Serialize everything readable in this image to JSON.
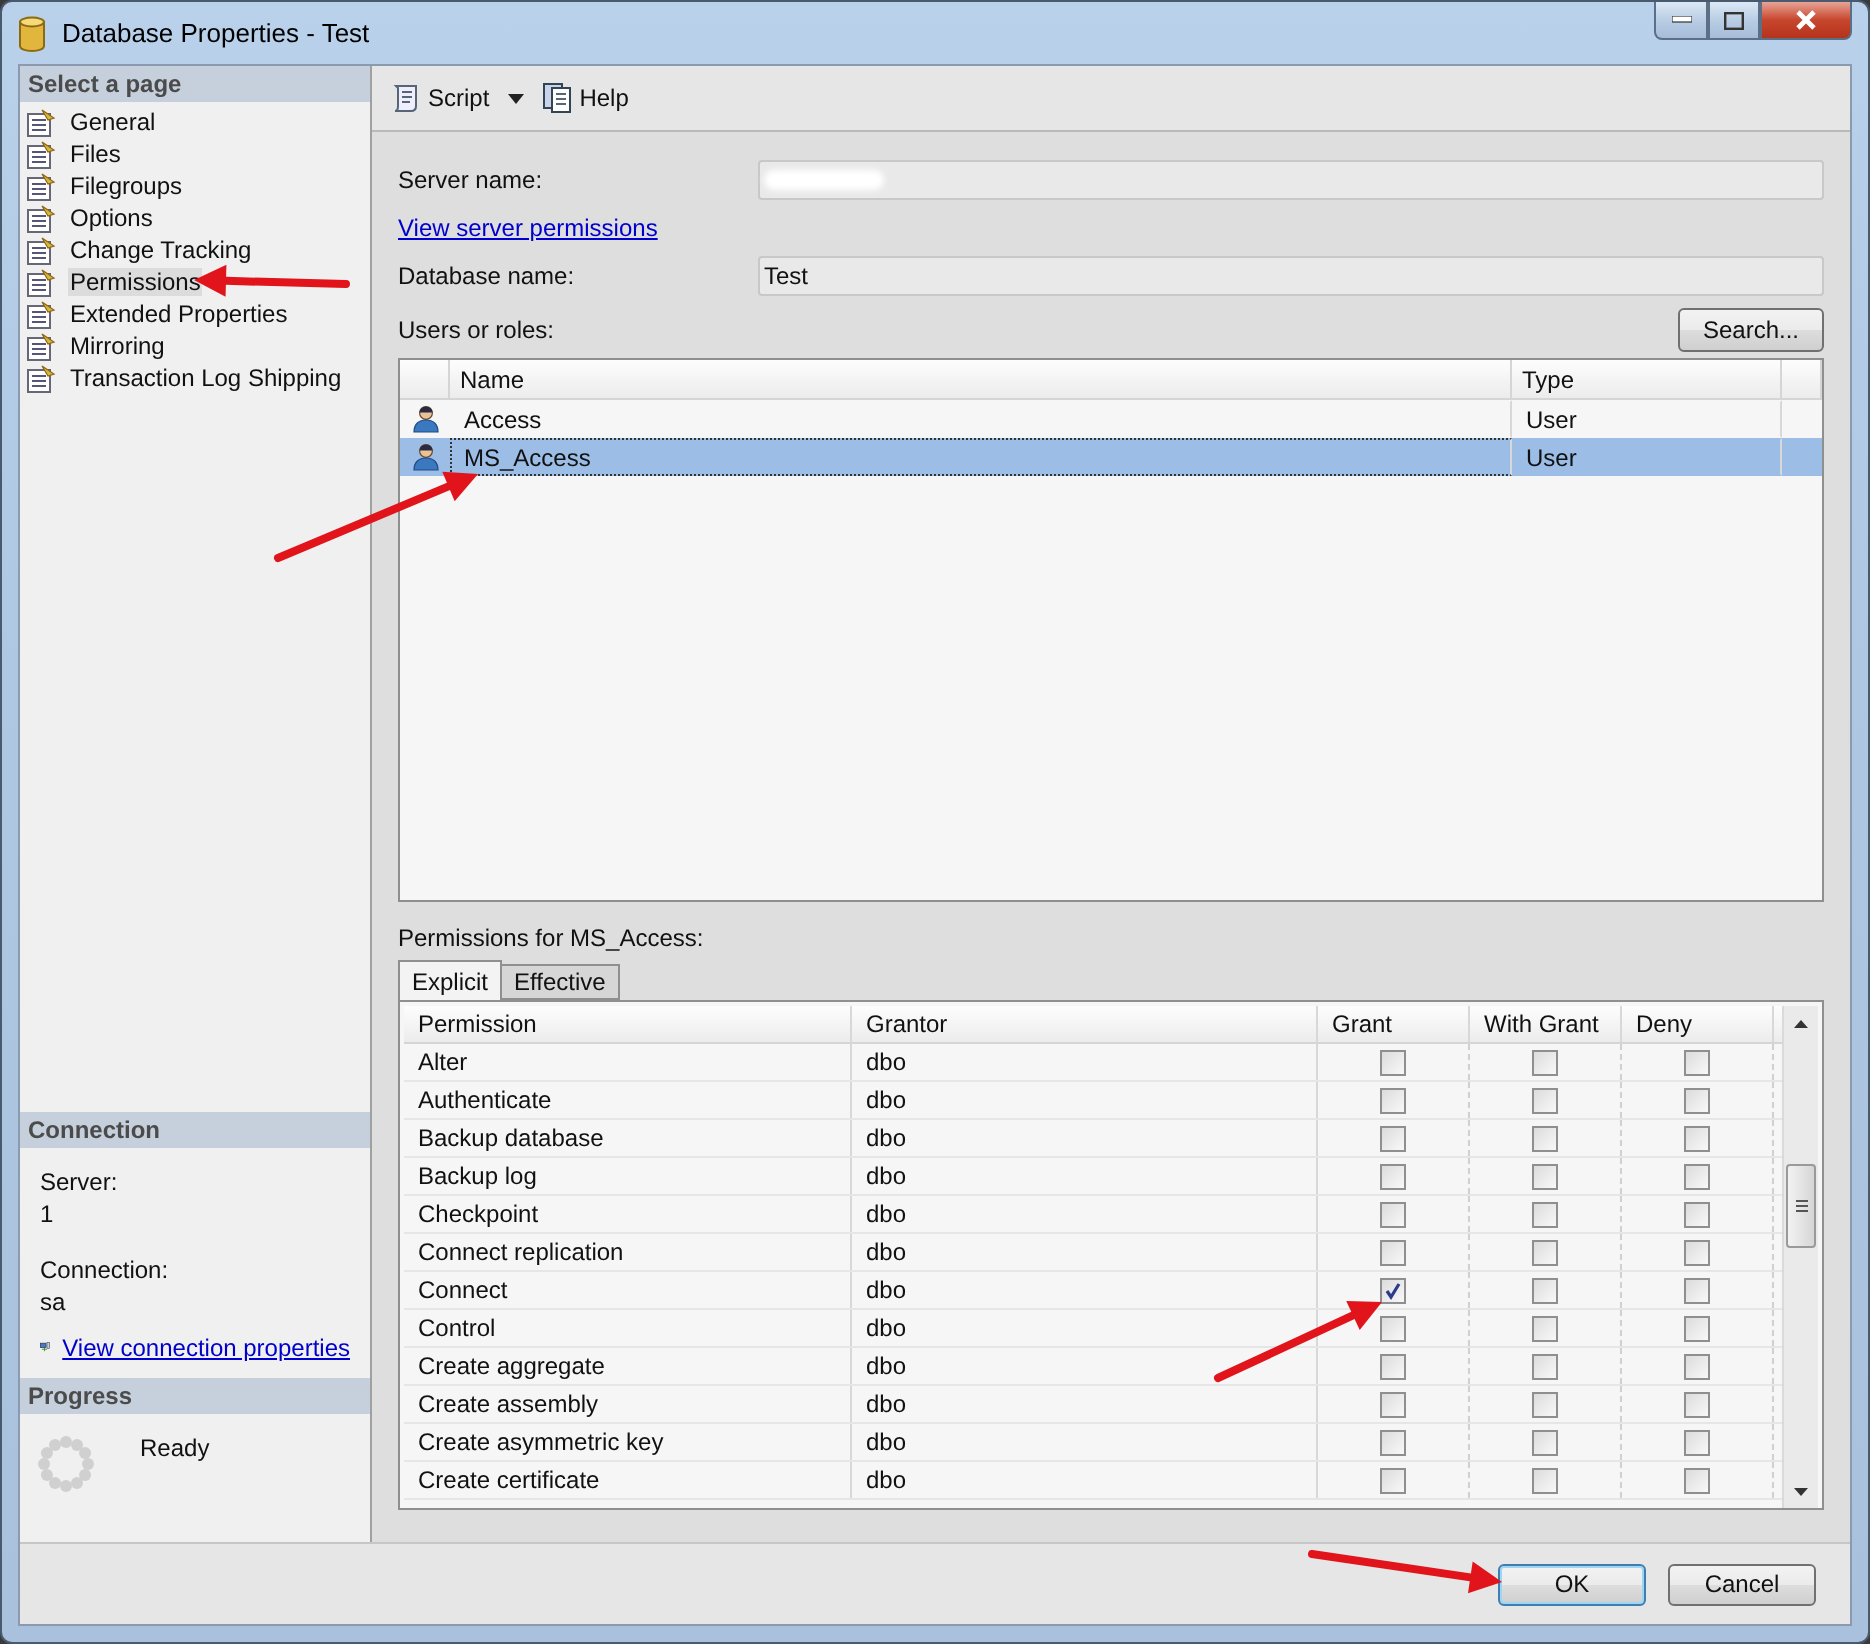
{
  "window": {
    "title": "Database Properties - Test"
  },
  "sidebar": {
    "title": "Select a page",
    "items": [
      {
        "label": "General",
        "selected": false
      },
      {
        "label": "Files",
        "selected": false
      },
      {
        "label": "Filegroups",
        "selected": false
      },
      {
        "label": "Options",
        "selected": false
      },
      {
        "label": "Change Tracking",
        "selected": false
      },
      {
        "label": "Permissions",
        "selected": true
      },
      {
        "label": "Extended Properties",
        "selected": false
      },
      {
        "label": "Mirroring",
        "selected": false
      },
      {
        "label": "Transaction Log Shipping",
        "selected": false
      }
    ]
  },
  "connection": {
    "title": "Connection",
    "fields": [
      {
        "label": "Server:",
        "value": "1"
      },
      {
        "label": "Connection:",
        "value": "sa"
      }
    ],
    "link": "View connection properties"
  },
  "progress": {
    "title": "Progress",
    "status": "Ready"
  },
  "toolbar": {
    "items": [
      {
        "label": "Script",
        "kind": "dropdown"
      },
      {
        "label": "Help",
        "kind": "button"
      }
    ]
  },
  "form": {
    "server_name": {
      "label": "Server name:",
      "redacted": true
    },
    "server_permissions_link": "View server permissions",
    "database_name": {
      "label": "Database name:",
      "value": "Test"
    }
  },
  "users": {
    "label": "Users or roles:",
    "search_button": "Search...",
    "columns": [
      "Name",
      "Type"
    ],
    "rows": [
      {
        "name": "Access",
        "type": "User",
        "selected": false
      },
      {
        "name": "MS_Access",
        "type": "User",
        "selected": true
      }
    ]
  },
  "permissions": {
    "label": "Permissions for MS_Access:",
    "tabs": [
      {
        "label": "Explicit",
        "selected": true
      },
      {
        "label": "Effective",
        "selected": false
      }
    ],
    "columns": [
      "Permission",
      "Grantor",
      "Grant",
      "With Grant",
      "Deny"
    ],
    "rows": [
      {
        "permission": "Alter",
        "grantor": "dbo",
        "grant": false,
        "with_grant": false,
        "deny": false
      },
      {
        "permission": "Authenticate",
        "grantor": "dbo",
        "grant": false,
        "with_grant": false,
        "deny": false
      },
      {
        "permission": "Backup database",
        "grantor": "dbo",
        "grant": false,
        "with_grant": false,
        "deny": false
      },
      {
        "permission": "Backup log",
        "grantor": "dbo",
        "grant": false,
        "with_grant": false,
        "deny": false
      },
      {
        "permission": "Checkpoint",
        "grantor": "dbo",
        "grant": false,
        "with_grant": false,
        "deny": false
      },
      {
        "permission": "Connect replication",
        "grantor": "dbo",
        "grant": false,
        "with_grant": false,
        "deny": false
      },
      {
        "permission": "Connect",
        "grantor": "dbo",
        "grant": true,
        "with_grant": false,
        "deny": false
      },
      {
        "permission": "Control",
        "grantor": "dbo",
        "grant": false,
        "with_grant": false,
        "deny": false
      },
      {
        "permission": "Create aggregate",
        "grantor": "dbo",
        "grant": false,
        "with_grant": false,
        "deny": false
      },
      {
        "permission": "Create assembly",
        "grantor": "dbo",
        "grant": false,
        "with_grant": false,
        "deny": false
      },
      {
        "permission": "Create asymmetric key",
        "grantor": "dbo",
        "grant": false,
        "with_grant": false,
        "deny": false
      },
      {
        "permission": "Create certificate",
        "grantor": "dbo",
        "grant": false,
        "with_grant": false,
        "deny": false
      }
    ]
  },
  "buttons": [
    {
      "label": "OK",
      "default": true
    },
    {
      "label": "Cancel",
      "default": false
    }
  ]
}
